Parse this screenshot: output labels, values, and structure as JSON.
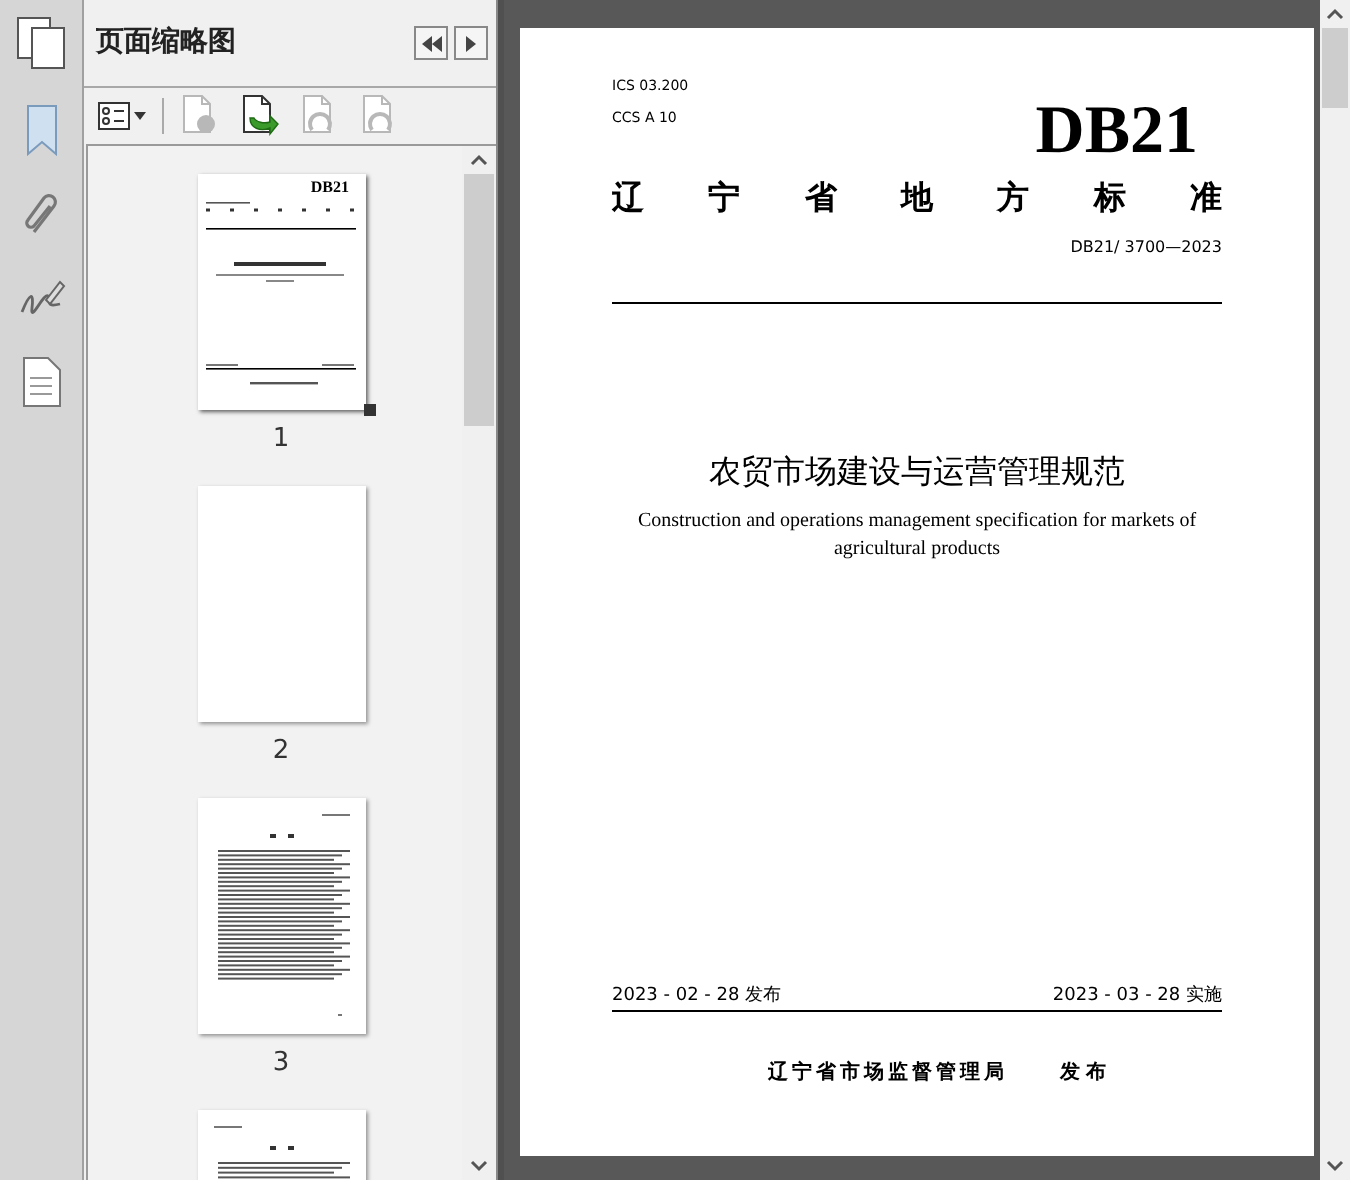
{
  "panel": {
    "title": "页面缩略图",
    "toolbar": [
      {
        "kind": "options",
        "disabled": false
      },
      {
        "kind": "delete",
        "disabled": true
      },
      {
        "kind": "insert",
        "disabled": false
      },
      {
        "kind": "rotate-left",
        "disabled": true
      },
      {
        "kind": "rotate-right",
        "disabled": true
      }
    ],
    "thumbnails": [
      {
        "kind": "cover",
        "label": "1",
        "heading": "DB21",
        "selected": true
      },
      {
        "kind": "blank",
        "label": "2",
        "selected": false
      },
      {
        "kind": "toc",
        "label": "3",
        "selected": false
      },
      {
        "kind": "text"
      }
    ]
  },
  "document": {
    "ics": "ICS 03.200",
    "ccs": "CCS A 10",
    "code": "DB21",
    "category": "辽宁省地方标准",
    "number": "DB21/ 3700—2023",
    "title_zh": "农贸市场建设与运营管理规范",
    "title_en": "Construction and operations management specification for markets of agricultural products",
    "issue_date": "2023 - 02 - 28 发布",
    "effective_date": "2023 - 03 - 28 实施",
    "publisher": "辽宁省市场监督管理局",
    "publisher_action": "发 布"
  }
}
